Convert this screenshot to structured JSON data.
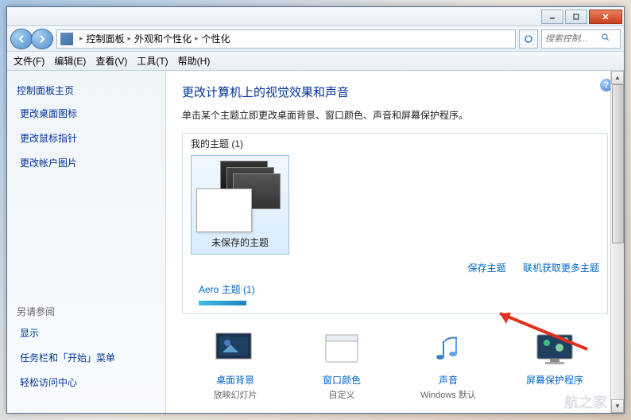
{
  "title_buttons": {
    "min": "—",
    "max": "☐",
    "close": "✕"
  },
  "breadcrumb": {
    "items": [
      "控制面板",
      "外观和个性化",
      "个性化"
    ]
  },
  "search": {
    "placeholder": "搜索控制..."
  },
  "menubar": {
    "file": "文件(F)",
    "edit": "编辑(E)",
    "view": "查看(V)",
    "tools": "工具(T)",
    "help": "帮助(H)"
  },
  "sidebar": {
    "home": "控制面板主页",
    "links": [
      "更改桌面图标",
      "更改鼠标指针",
      "更改帐户图片"
    ],
    "also_see": "另请参阅",
    "bottom_links": [
      "显示",
      "任务栏和「开始」菜单",
      "轻松访问中心"
    ]
  },
  "main": {
    "title": "更改计算机上的视觉效果和声音",
    "desc": "单击某个主题立即更改桌面背景、窗口颜色、声音和屏幕保护程序。",
    "my_themes_title": "我的主题 (1)",
    "unsaved_theme": "未保存的主题",
    "save_theme": "保存主题",
    "get_more_online": "联机获取更多主题",
    "aero_title": "Aero 主题 (1)"
  },
  "bottom": {
    "items": [
      {
        "label": "桌面背景",
        "sub": "放映幻灯片"
      },
      {
        "label": "窗口颜色",
        "sub": "自定义"
      },
      {
        "label": "声音",
        "sub": "Windows 默认"
      },
      {
        "label": "屏幕保护程序",
        "sub": ""
      }
    ]
  },
  "help": "?",
  "watermark": "航之家"
}
